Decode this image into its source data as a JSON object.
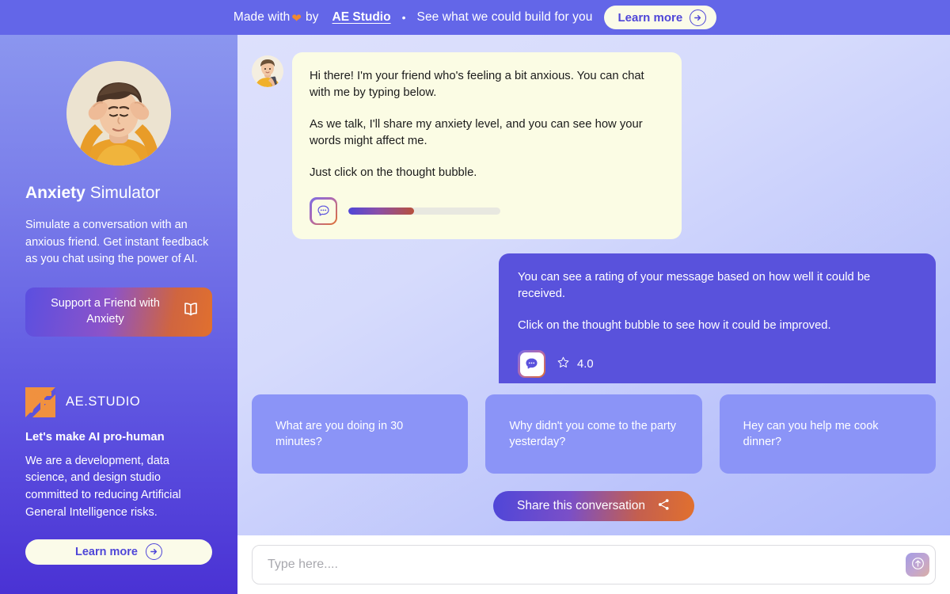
{
  "banner": {
    "prefix": "Made with ",
    "heart_icon": "heart-icon",
    "by": "by",
    "brand_link": "AE Studio",
    "separator": "•",
    "tagline": "See what we could build for you",
    "cta_label": "Learn more",
    "cta_icon": "arrow-right-circle-icon",
    "bg_color": "#6366e8",
    "cta_bg_color": "#fbfbe9",
    "cta_text_color": "#4f46d8",
    "heart_color": "#f0892f"
  },
  "sidebar": {
    "avatar_icon": "anxious-person-avatar",
    "title_bold": "Anxiety",
    "title_rest": " Simulator",
    "description": "Simulate a conversation with an anxious friend. Get instant feedback as you chat using the power of AI.",
    "support_button": {
      "label": "Support a Friend with Anxiety",
      "icon": "open-book-icon"
    },
    "studio": {
      "logo_icon": "ae-studio-logo-icon",
      "name": "AE.STUDIO",
      "tagline": "Let's make AI pro-human",
      "description": "We are a development, data science, and design studio committed to reducing Artificial General Intelligence risks.",
      "learn_more_label": "Learn more",
      "learn_more_icon": "arrow-right-circle-icon"
    },
    "gradient_top": "#8b96ef",
    "gradient_bottom": "#4a32d4"
  },
  "chat": {
    "messages": [
      {
        "role": "bot",
        "avatar_icon": "friend-avatar",
        "paragraphs": [
          "Hi there! I'm your friend who's feeling a bit anxious. You can chat with me by typing below.",
          "As we talk, I'll share my anxiety level, and you can see how your words might affect me.",
          "Just click on the thought bubble."
        ],
        "thought_icon": "thought-bubble-icon",
        "anxiety_percent": 43,
        "bubble_bg": "#fbfce4",
        "bar_fill_start": "#4f46d8",
        "bar_fill_end": "#b7503d"
      },
      {
        "role": "user",
        "paragraphs": [
          "You can see a rating of your message based on how well it could be received.",
          "Click on the thought bubble to see how it could be improved."
        ],
        "thought_icon": "thought-bubble-icon",
        "star_icon": "star-outline-icon",
        "rating": "4.0",
        "bubble_bg": "#5952dc"
      }
    ]
  },
  "suggestions": [
    {
      "label": "What are you doing in 30 minutes?"
    },
    {
      "label": "Why didn't you come to the party yesterday?"
    },
    {
      "label": "Hey can you help me cook dinner?"
    }
  ],
  "share": {
    "label": "Share this conversation",
    "icon": "share-nodes-icon"
  },
  "composer": {
    "placeholder": "Type here....",
    "value": "",
    "send_icon": "arrow-up-circle-icon"
  }
}
